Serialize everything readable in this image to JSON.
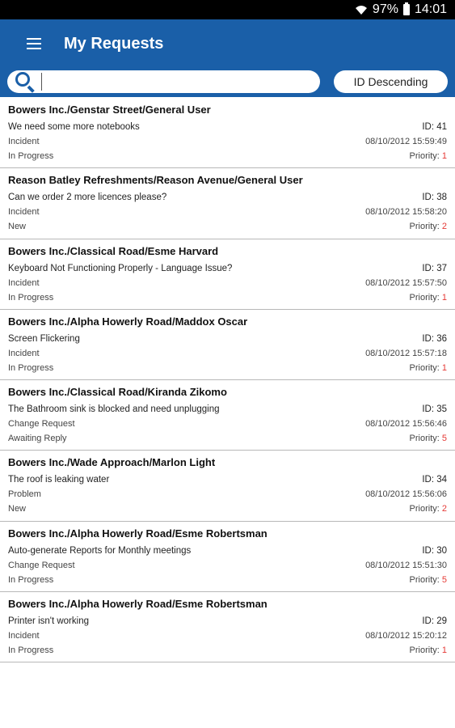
{
  "status_bar": {
    "battery": "97%",
    "time": "14:01"
  },
  "app_bar": {
    "title": "My Requests"
  },
  "search": {
    "placeholder": "",
    "value": ""
  },
  "sort": {
    "label": "ID Descending"
  },
  "requests": [
    {
      "title": "Bowers Inc./Genstar Street/General User",
      "summary": "We need some more notebooks",
      "id": "ID: 41",
      "type": "Incident",
      "date": "08/10/2012 15:59:49",
      "status": "In Progress",
      "priority_label": "Priority: ",
      "priority": "1"
    },
    {
      "title": "Reason Batley Refreshments/Reason Avenue/General User",
      "summary": "Can we order 2 more licences please?",
      "id": "ID: 38",
      "type": "Incident",
      "date": "08/10/2012 15:58:20",
      "status": "New",
      "priority_label": "Priority: ",
      "priority": "2"
    },
    {
      "title": "Bowers Inc./Classical Road/Esme Harvard",
      "summary": "Keyboard Not Functioning Properly - Language Issue?",
      "id": "ID: 37",
      "type": "Incident",
      "date": "08/10/2012 15:57:50",
      "status": "In Progress",
      "priority_label": "Priority: ",
      "priority": "1"
    },
    {
      "title": "Bowers Inc./Alpha Howerly Road/Maddox Oscar",
      "summary": "Screen Flickering",
      "id": "ID: 36",
      "type": "Incident",
      "date": "08/10/2012 15:57:18",
      "status": "In Progress",
      "priority_label": "Priority: ",
      "priority": "1"
    },
    {
      "title": "Bowers Inc./Classical Road/Kiranda Zikomo",
      "summary": "The Bathroom sink is blocked and need unplugging",
      "id": "ID: 35",
      "type": "Change Request",
      "date": "08/10/2012 15:56:46",
      "status": "Awaiting Reply",
      "priority_label": "Priority: ",
      "priority": "5"
    },
    {
      "title": "Bowers Inc./Wade Approach/Marlon Light",
      "summary": "The roof is leaking water",
      "id": "ID: 34",
      "type": "Problem",
      "date": "08/10/2012 15:56:06",
      "status": "New",
      "priority_label": "Priority: ",
      "priority": "2"
    },
    {
      "title": "Bowers Inc./Alpha Howerly Road/Esme Robertsman",
      "summary": "Auto-generate Reports for Monthly meetings",
      "id": "ID: 30",
      "type": "Change Request",
      "date": "08/10/2012 15:51:30",
      "status": "In Progress",
      "priority_label": "Priority: ",
      "priority": "5"
    },
    {
      "title": "Bowers Inc./Alpha Howerly Road/Esme Robertsman",
      "summary": "Printer isn't working",
      "id": "ID: 29",
      "type": "Incident",
      "date": "08/10/2012 15:20:12",
      "status": "In Progress",
      "priority_label": "Priority: ",
      "priority": "1"
    }
  ],
  "colors": {
    "app_bar": "#1a5fa8",
    "priority": "#e53935"
  },
  "icons": [
    "wifi-icon",
    "battery-icon",
    "menu-icon",
    "search-icon"
  ]
}
